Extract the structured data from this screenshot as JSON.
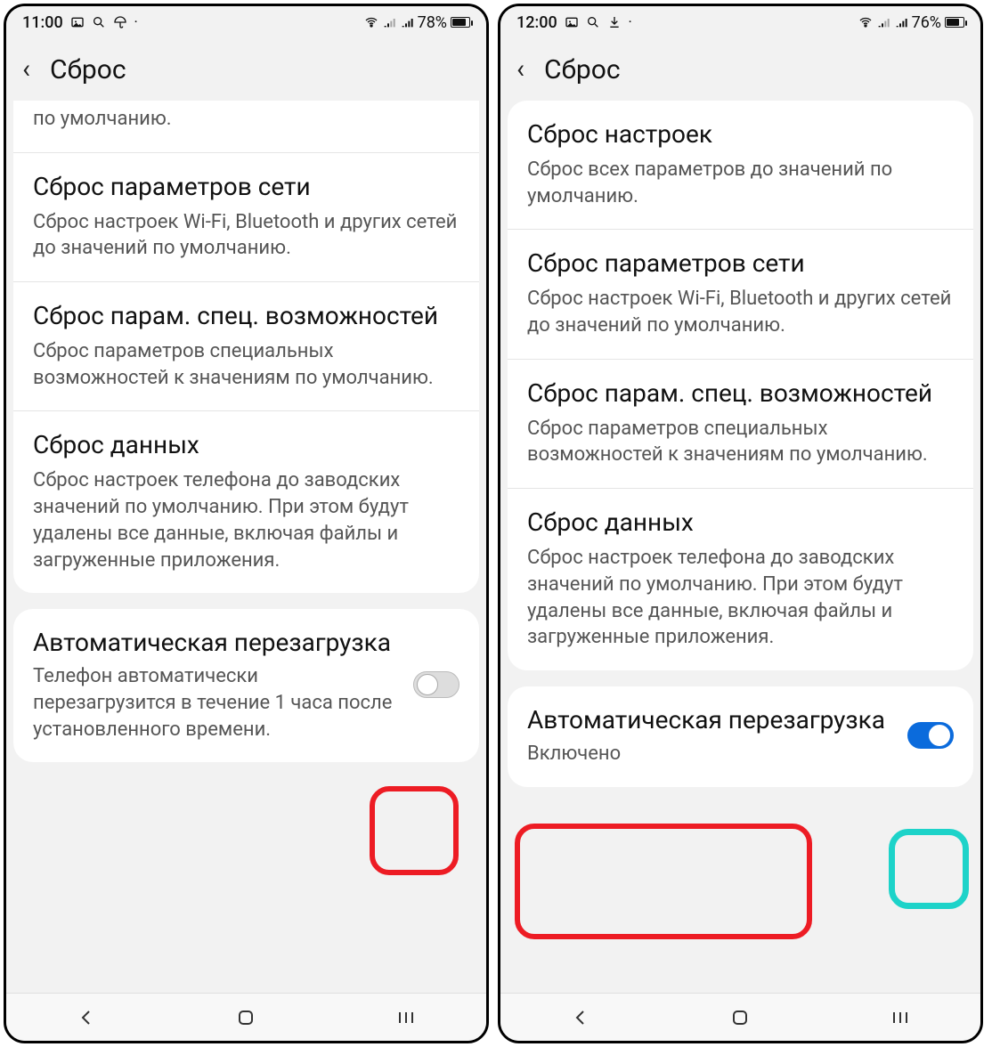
{
  "screens": [
    {
      "statusbar": {
        "time": "11:00",
        "battery_pct": "78%",
        "battery_fill_css": "width:15px"
      },
      "header": {
        "title": "Сброс"
      },
      "partial_item_desc": "по умолчанию.",
      "items": [
        {
          "title": "Сброс параметров сети",
          "desc": "Сброс настроек Wi-Fi, Bluetooth и других сетей до значений по умолчанию."
        },
        {
          "title": "Сброс парам. спец. возможностей",
          "desc": "Сброс параметров специальных возможностей к значениям по умолчанию."
        },
        {
          "title": "Сброс данных",
          "desc": "Сброс настроек телефона до заводских значений по умолчанию. При этом будут удалены все данные, включая файлы и загруженные приложения."
        }
      ],
      "toggle": {
        "title": "Автоматическая перезагрузка",
        "desc": "Телефон автоматически перезагрузится в течение 1 часа после установленного времени.",
        "on": false
      },
      "highlights": [
        {
          "kind": "red",
          "style": "left:408px; top:876px; width:100px; height:100px;"
        }
      ]
    },
    {
      "statusbar": {
        "time": "12:00",
        "battery_pct": "76%",
        "battery_fill_css": "width:14px"
      },
      "header": {
        "title": "Сброс"
      },
      "items": [
        {
          "title": "Сброс настроек",
          "desc": "Сброс всех параметров до значений по умолчанию."
        },
        {
          "title": "Сброс параметров сети",
          "desc": "Сброс настроек Wi-Fi, Bluetooth и других сетей до значений по умолчанию."
        },
        {
          "title": "Сброс парам. спец. возможностей",
          "desc": "Сброс параметров специальных возможностей к значениям по умолчанию."
        },
        {
          "title": "Сброс данных",
          "desc": "Сброс настроек телефона до заводских значений по умолчанию. При этом будут удалены все данные, включая файлы и загруженные приложения."
        }
      ],
      "toggle": {
        "title": "Автоматическая перезагрузка",
        "desc": "Включено",
        "on": true
      },
      "highlights": [
        {
          "kind": "red",
          "style": "left:16px;  top:918px; width:334px; height:130px;"
        },
        {
          "kind": "teal",
          "style": "left:436px; top:924px; width:90px;  height:90px;"
        }
      ]
    }
  ]
}
